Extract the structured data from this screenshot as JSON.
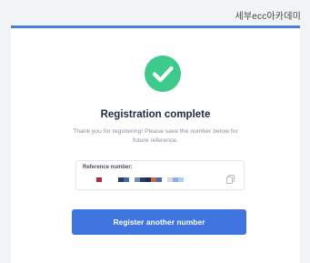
{
  "watermark": "세부ecc아카데미",
  "header": {
    "title": "Registration complete",
    "description": "Thank you for registering! Please save the number below for future reference."
  },
  "reference": {
    "label": "Reference number:",
    "value_redacted": true,
    "redaction_colors": [
      "#b3273a",
      "#2b3b5c",
      "#3b6ea8",
      "#7a8fb8",
      "#1e2c52",
      "#c86a4a",
      "#4a6bb5",
      "#d6dbe6",
      "#8bb2d8",
      "#a8d4e6"
    ]
  },
  "actions": {
    "primary_label": "Register another number"
  },
  "colors": {
    "accent": "#4074de",
    "success": "#3ec98d",
    "title": "#1f2a44",
    "muted": "#8a8f9a"
  }
}
